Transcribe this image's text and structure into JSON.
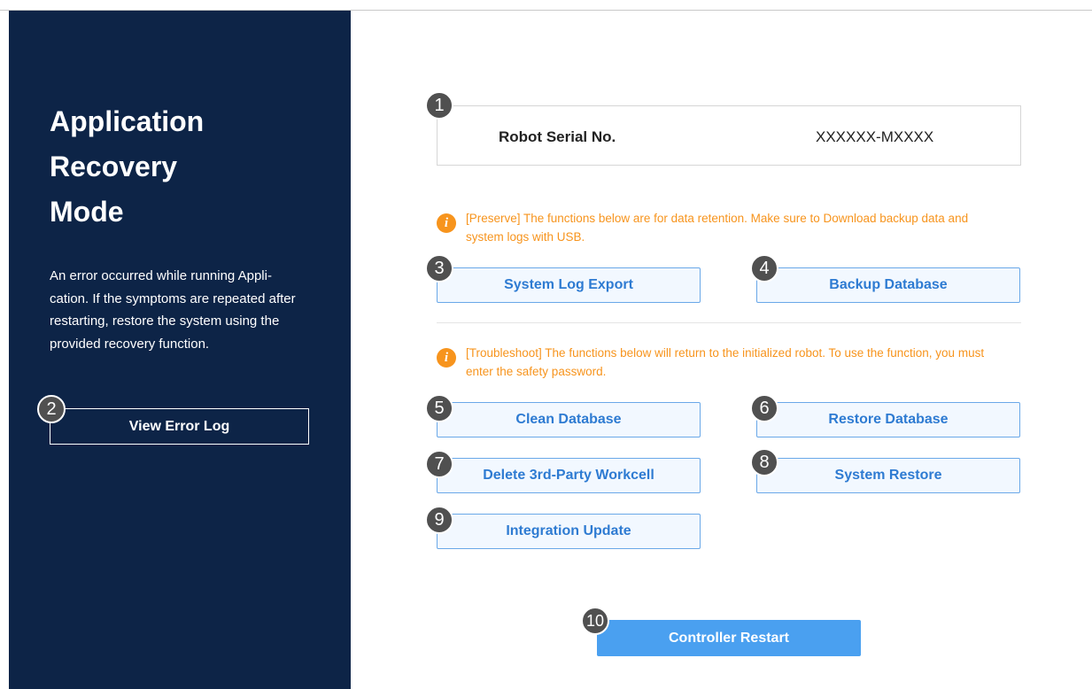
{
  "sidebar": {
    "title_lines": [
      "Application",
      "Recovery",
      "Mode"
    ],
    "description": "An error occurred while running Appli-cation. If the symptoms are repeated after restarting, restore the system using the provided recovery function.",
    "view_error_log_label": "View Error Log",
    "view_error_log_badge": "2"
  },
  "serial": {
    "badge": "1",
    "label": "Robot Serial No.",
    "value": "XXXXXX-MXXXX"
  },
  "notices": {
    "icon_glyph": "i",
    "preserve": "[Preserve] The functions below are for data retention. Make sure to Download backup data and system logs with USB.",
    "troubleshoot": "[Troubleshoot] The functions below will return to the initialized robot. To use the function, you must enter the safety password."
  },
  "buttons": {
    "system_log_export": {
      "label": "System Log Export",
      "badge": "3"
    },
    "backup_database": {
      "label": "Backup Database",
      "badge": "4"
    },
    "clean_database": {
      "label": "Clean Database",
      "badge": "5"
    },
    "restore_database": {
      "label": "Restore Database",
      "badge": "6"
    },
    "delete_3rd_party_workcell": {
      "label": "Delete 3rd-Party Workcell",
      "badge": "7"
    },
    "system_restore": {
      "label": "System Restore",
      "badge": "8"
    },
    "integration_update": {
      "label": "Integration Update",
      "badge": "9"
    },
    "controller_restart": {
      "label": "Controller Restart",
      "badge": "10"
    }
  },
  "colors": {
    "sidebar_bg": "#0d2447",
    "accent_blue": "#2e7bd2",
    "primary_button": "#4aa0f0",
    "notice_orange": "#f7941d",
    "badge_gray": "#505050"
  }
}
